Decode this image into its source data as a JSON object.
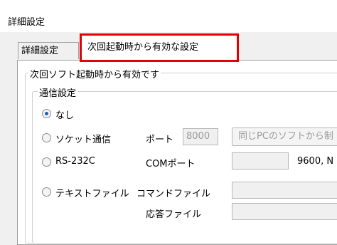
{
  "window": {
    "title": "詳細設定"
  },
  "tabs": [
    {
      "label": "詳細設定"
    },
    {
      "label": "次回起動時から有効な設定",
      "highlight_color": "#e30000"
    }
  ],
  "panel": {
    "group_title": "次回ソフト起動時から有効です",
    "comm": {
      "title": "通信設定",
      "options": [
        {
          "label": "なし",
          "selected": true
        },
        {
          "label": "ソケット通信",
          "selected": false
        },
        {
          "label": "RS-232C",
          "selected": false
        },
        {
          "label": "テキストファイル",
          "selected": false
        }
      ],
      "port_label": "ポート",
      "port_value": "8000",
      "same_pc_button": "同じPCのソフトから制",
      "com_port_label": "COMポート",
      "com_port_value": "",
      "baud_text": "9600, N",
      "command_file_label": "コマンドファイル",
      "command_file_value": "",
      "response_file_label": "応答ファイル",
      "response_file_value": ""
    }
  }
}
